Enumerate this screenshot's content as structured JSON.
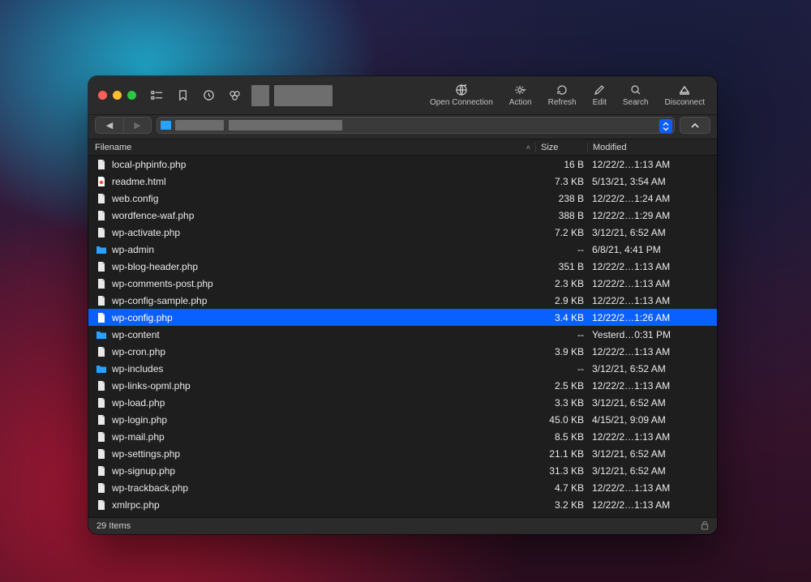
{
  "toolbar": {
    "open_connection": "Open Connection",
    "action": "Action",
    "refresh": "Refresh",
    "edit": "Edit",
    "search": "Search",
    "disconnect": "Disconnect"
  },
  "columns": {
    "name": "Filename",
    "size": "Size",
    "modified": "Modified"
  },
  "footer": {
    "count": "29 Items"
  },
  "files": [
    {
      "icon": "file",
      "name": "local-phpinfo.php",
      "size": "16 B",
      "modified": "12/22/2…1:13 AM",
      "selected": false
    },
    {
      "icon": "html",
      "name": "readme.html",
      "size": "7.3 KB",
      "modified": "5/13/21, 3:54 AM",
      "selected": false
    },
    {
      "icon": "file",
      "name": "web.config",
      "size": "238 B",
      "modified": "12/22/2…1:24 AM",
      "selected": false
    },
    {
      "icon": "file",
      "name": "wordfence-waf.php",
      "size": "388 B",
      "modified": "12/22/2…1:29 AM",
      "selected": false
    },
    {
      "icon": "file",
      "name": "wp-activate.php",
      "size": "7.2 KB",
      "modified": "3/12/21, 6:52 AM",
      "selected": false
    },
    {
      "icon": "folder",
      "name": "wp-admin",
      "size": "--",
      "modified": "6/8/21, 4:41 PM",
      "selected": false
    },
    {
      "icon": "file",
      "name": "wp-blog-header.php",
      "size": "351 B",
      "modified": "12/22/2…1:13 AM",
      "selected": false
    },
    {
      "icon": "file",
      "name": "wp-comments-post.php",
      "size": "2.3 KB",
      "modified": "12/22/2…1:13 AM",
      "selected": false
    },
    {
      "icon": "file",
      "name": "wp-config-sample.php",
      "size": "2.9 KB",
      "modified": "12/22/2…1:13 AM",
      "selected": false
    },
    {
      "icon": "file",
      "name": "wp-config.php",
      "size": "3.4 KB",
      "modified": "12/22/2…1:26 AM",
      "selected": true
    },
    {
      "icon": "folder",
      "name": "wp-content",
      "size": "--",
      "modified": "Yesterd…0:31 PM",
      "selected": false
    },
    {
      "icon": "file",
      "name": "wp-cron.php",
      "size": "3.9 KB",
      "modified": "12/22/2…1:13 AM",
      "selected": false
    },
    {
      "icon": "folder",
      "name": "wp-includes",
      "size": "--",
      "modified": "3/12/21, 6:52 AM",
      "selected": false
    },
    {
      "icon": "file",
      "name": "wp-links-opml.php",
      "size": "2.5 KB",
      "modified": "12/22/2…1:13 AM",
      "selected": false
    },
    {
      "icon": "file",
      "name": "wp-load.php",
      "size": "3.3 KB",
      "modified": "3/12/21, 6:52 AM",
      "selected": false
    },
    {
      "icon": "file",
      "name": "wp-login.php",
      "size": "45.0 KB",
      "modified": "4/15/21, 9:09 AM",
      "selected": false
    },
    {
      "icon": "file",
      "name": "wp-mail.php",
      "size": "8.5 KB",
      "modified": "12/22/2…1:13 AM",
      "selected": false
    },
    {
      "icon": "file",
      "name": "wp-settings.php",
      "size": "21.1 KB",
      "modified": "3/12/21, 6:52 AM",
      "selected": false
    },
    {
      "icon": "file",
      "name": "wp-signup.php",
      "size": "31.3 KB",
      "modified": "3/12/21, 6:52 AM",
      "selected": false
    },
    {
      "icon": "file",
      "name": "wp-trackback.php",
      "size": "4.7 KB",
      "modified": "12/22/2…1:13 AM",
      "selected": false
    },
    {
      "icon": "file",
      "name": "xmlrpc.php",
      "size": "3.2 KB",
      "modified": "12/22/2…1:13 AM",
      "selected": false
    }
  ]
}
